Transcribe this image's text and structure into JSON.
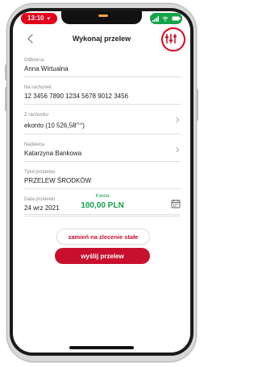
{
  "status_bar": {
    "time": "13:10"
  },
  "header": {
    "title": "Wykonaj przelew"
  },
  "fields": [
    {
      "label": "Odbiorca",
      "value": "Anna Wirtualna"
    },
    {
      "label": "Na rachunek",
      "value": "12 3456 7890 1234 5678 9012 3456"
    },
    {
      "label": "Z rachunku",
      "value": "ekonto (10 526,58",
      "value_suffix": "PLN",
      "value_close": ")"
    },
    {
      "label": "Nadawca",
      "value": "Katarzyna Bankowa"
    },
    {
      "label": "Tytuł przelewu",
      "value": "PRZELEW ŚRODKÓW"
    },
    {
      "label": "Data przelewu",
      "value": "24 wrz 2021"
    }
  ],
  "amount": {
    "label": "Kwota",
    "value": "100,00 PLN"
  },
  "buttons": {
    "standing_order": "zamień na zlecenie stałe",
    "send": "wyślij przelew"
  },
  "colors": {
    "brand_red": "#c8102e",
    "accent_green": "#15a34a"
  },
  "icons": [
    "back-arrow-icon",
    "settings-sliders-icon",
    "chevron-right-icon",
    "calendar-icon",
    "wifi-icon",
    "battery-icon",
    "location-arrow-icon"
  ]
}
